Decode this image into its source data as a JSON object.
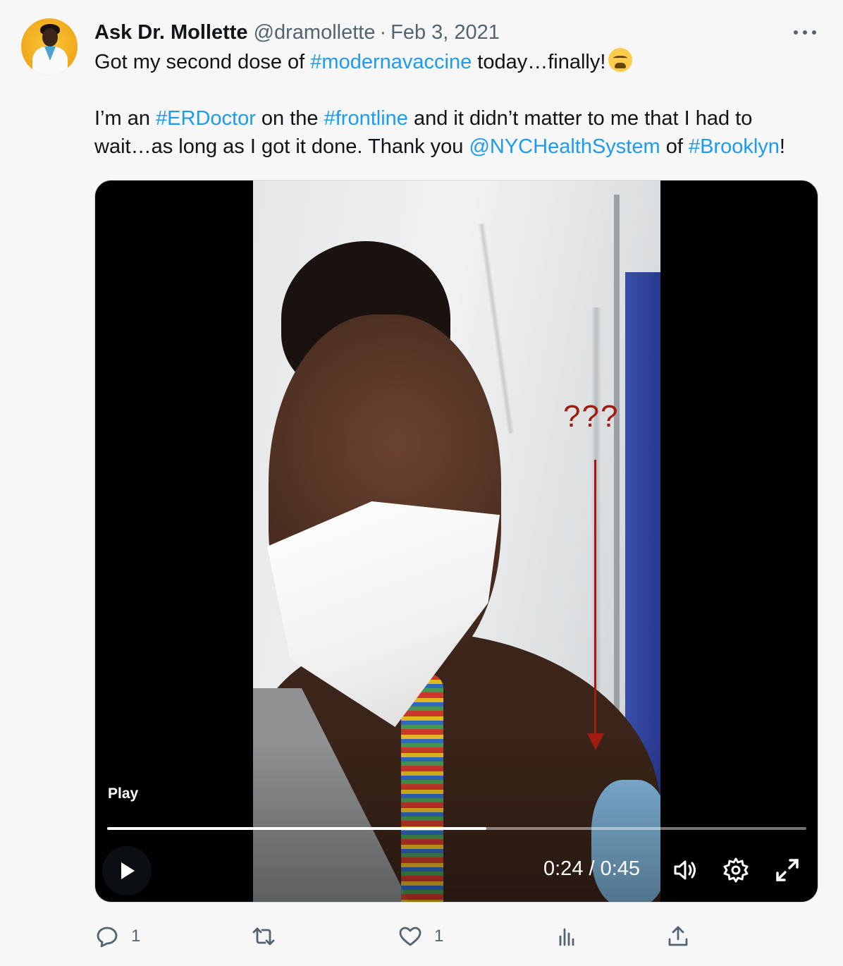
{
  "author": {
    "name": "Ask Dr. Mollette",
    "handle": "@dramollette",
    "separator": "·",
    "date": "Feb 3, 2021"
  },
  "tweet": {
    "line1": {
      "a": "Got my second dose of ",
      "tag": "#modernavaccine",
      "b": " today…finally!"
    },
    "line2": {
      "a": "I’m an ",
      "tag1": "#ERDoctor",
      "b": " on the ",
      "tag2": "#frontline",
      "c": " and it didn’t matter to me that I had to"
    },
    "line3": {
      "a": "wait…as long as I got it done. Thank you ",
      "mention": "@NYCHealthSystem",
      "b": " of ",
      "tag": "#Brooklyn",
      "c": "!"
    },
    "emoji": "weary-face"
  },
  "video": {
    "annotation": "???",
    "play_tooltip": "Play",
    "time": "0:24 / 0:45",
    "progress_fraction": 0.542
  },
  "actions": {
    "replies": "1",
    "retweets": "",
    "likes": "1",
    "views": ""
  },
  "colors": {
    "link": "#1d9bf0",
    "secondary": "#536471",
    "annotation": "#a01c10"
  }
}
